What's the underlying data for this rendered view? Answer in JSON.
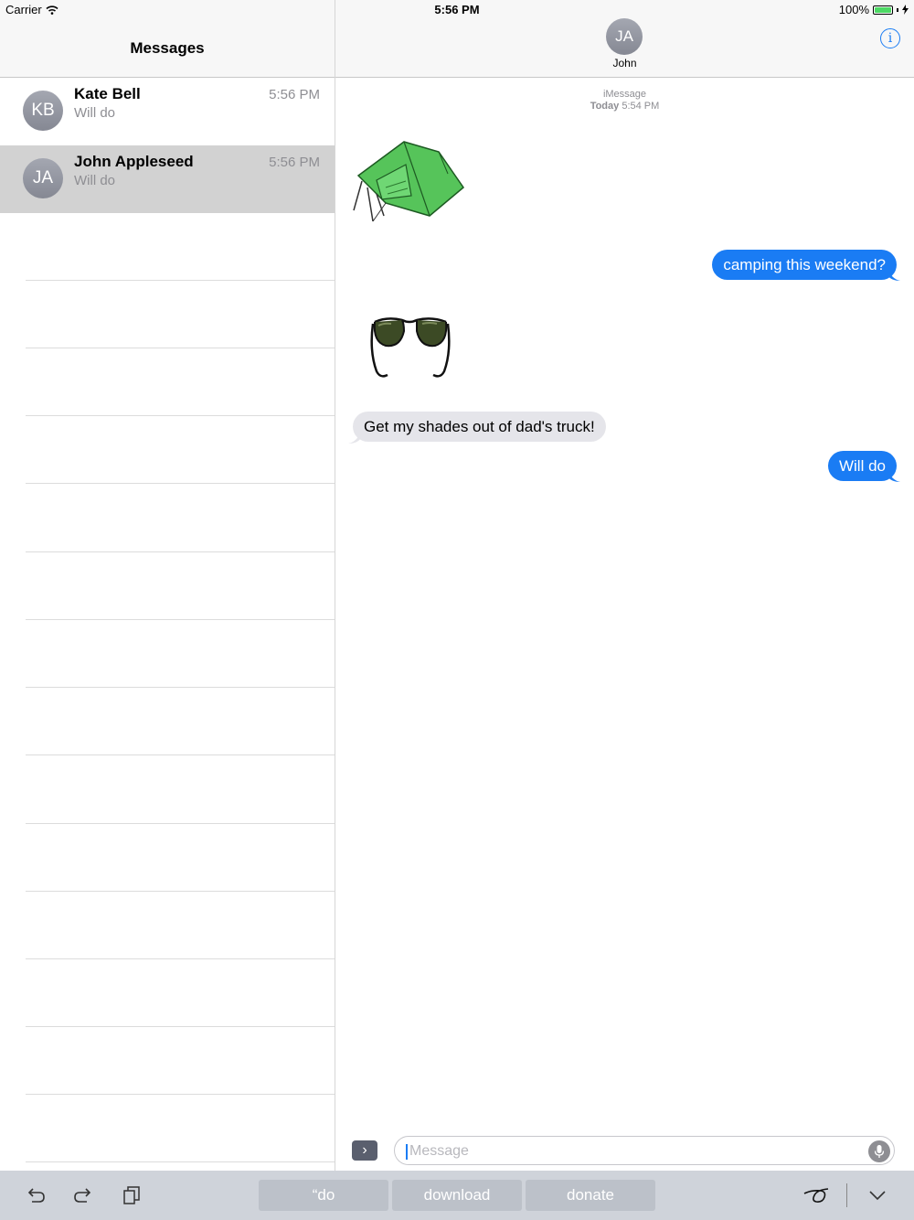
{
  "status_bar": {
    "carrier": "Carrier",
    "time": "5:56 PM",
    "battery": "100%"
  },
  "left_pane": {
    "title": "Messages",
    "conversations": [
      {
        "initials": "KB",
        "name": "Kate Bell",
        "time": "5:56 PM",
        "preview": "Will do"
      },
      {
        "initials": "JA",
        "name": "John Appleseed",
        "time": "5:56 PM",
        "preview": "Will do"
      }
    ]
  },
  "chat": {
    "contact_initials": "JA",
    "contact_name": "John",
    "meta_service": "iMessage",
    "meta_day": "Today",
    "meta_time": "5:54 PM",
    "messages": [
      {
        "kind": "sticker",
        "icon": "tent-sticker"
      },
      {
        "kind": "text",
        "direction": "outgoing",
        "text": "camping this weekend?"
      },
      {
        "kind": "sticker",
        "icon": "sunglasses-sticker"
      },
      {
        "kind": "text",
        "direction": "incoming",
        "text": "Get my shades out of dad's truck!"
      },
      {
        "kind": "text",
        "direction": "outgoing",
        "text": "Will do"
      }
    ],
    "input_placeholder": "Message"
  },
  "keyboard_bar": {
    "suggestions": [
      "“do",
      "download",
      "donate"
    ]
  },
  "colors": {
    "accent": "#1a7cf4",
    "incoming_bubble": "#e5e5ea",
    "battery": "#4cd964"
  }
}
